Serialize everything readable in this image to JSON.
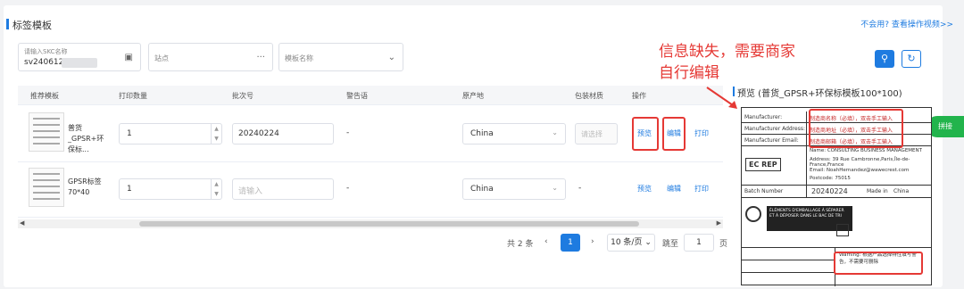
{
  "page": {
    "title": "标签模板",
    "help_link": "不会用? 查看操作视频>>"
  },
  "filters": {
    "skc": {
      "label": "请输入SKC名称",
      "value": "sv2406120"
    },
    "site": {
      "placeholder": "站点"
    },
    "template": {
      "placeholder": "模板名称"
    }
  },
  "buttons": {
    "search_icon": "search-icon",
    "refresh_icon": "refresh-icon"
  },
  "table": {
    "columns": [
      "推荐模板",
      "打印数量",
      "批次号",
      "警告语",
      "原产地",
      "包装材质",
      "操作"
    ],
    "rows": [
      {
        "template": "普货_GPSR+环保标...",
        "quantity": "1",
        "batch": "20240224",
        "batch_placeholder": "",
        "warning": "-",
        "origin": "China",
        "packaging": "请选择",
        "actions": [
          "预览",
          "编辑",
          "打印"
        ]
      },
      {
        "template": "GPSR标签70*40",
        "quantity": "1",
        "batch": "",
        "batch_placeholder": "请输入",
        "warning": "-",
        "origin": "China",
        "packaging": "-",
        "actions": [
          "预览",
          "编辑",
          "打印"
        ]
      }
    ]
  },
  "pagination": {
    "total": "共 2 条",
    "current": "1",
    "per_page": "10 条/页",
    "jump_label": "跳至",
    "jump_value": "1",
    "page_suffix": "页"
  },
  "annotation": {
    "line1": "信息缺失，需要商家",
    "line2": "自行编辑",
    "color": "#e53935"
  },
  "preview": {
    "title": "预览 (普货_GPSR+环保标模板100*100)",
    "side_tab": "拼接",
    "rows": [
      {
        "key": "Manufacturer:",
        "value": "制造商名称（必填），双击手工输入"
      },
      {
        "key": "Manufacturer Address:",
        "value": "制造商地址（必填），双击手工输入"
      },
      {
        "key": "Manufacturer Email:",
        "value": "制造商邮箱（必填），双击手工输入"
      }
    ],
    "ec_rep": "EC REP",
    "rep_name": "Name:   CONSULTING BUSINESS MANAGEMENT",
    "rep_address": "Address: 39 Rue Cambronne,Paris,Île-de-France,France",
    "rep_email": "Email:   NoahHernandez@wawecrest.com",
    "rep_postcode": "Postcode: 75015",
    "batch_label": "Batch Number",
    "batch_value": "20240224",
    "made_in_label": "Made in",
    "made_in_value": "China",
    "recycle_text": "ÉLÉMENTS D'EMBALLAGE À SÉPARER ET À DÉPOSER DANS LE BAC DE TRI",
    "warning_text": "Warning: 根据产品选择特性填写警告，不需要可删除"
  },
  "accent": "#1e7be0"
}
